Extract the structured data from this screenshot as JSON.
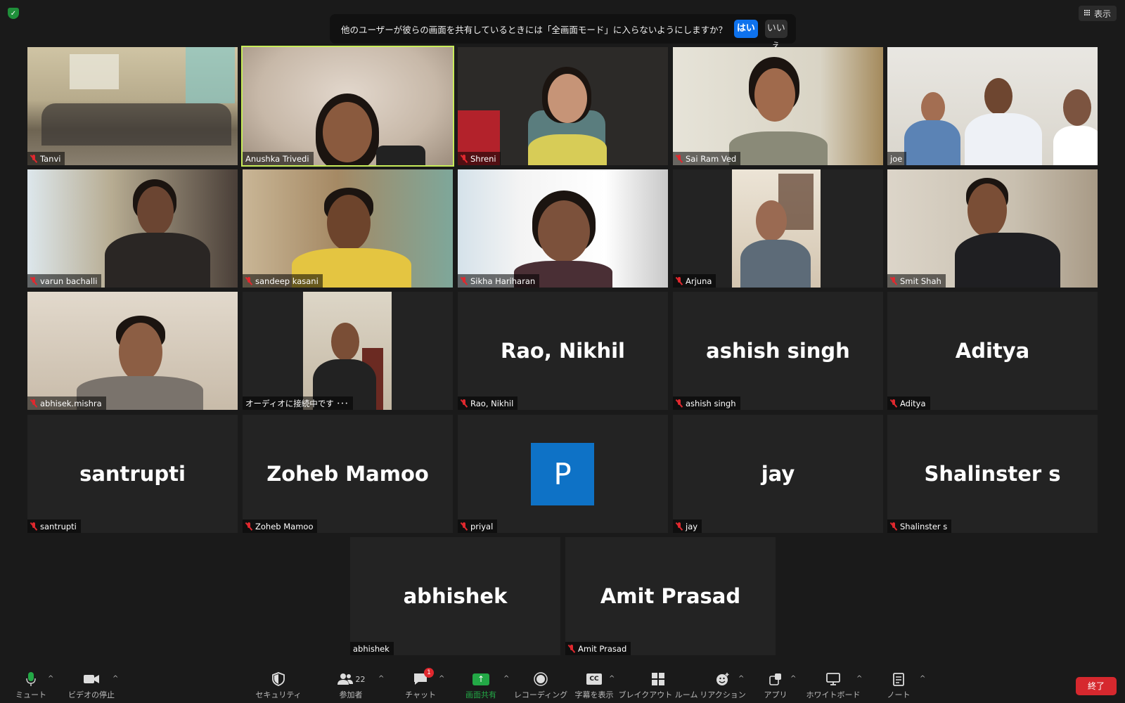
{
  "top": {
    "view_label": "表示",
    "banner_text": "他のユーザーが彼らの画面を共有しているときには「全画面モード」に入らないようにしますか？",
    "yes_label": "はい",
    "no_label": "いいえ"
  },
  "participants": [
    {
      "name": "Tanvi",
      "muted": true
    },
    {
      "name": "Anushka Trivedi",
      "muted": false
    },
    {
      "name": "Shreni",
      "muted": true
    },
    {
      "name": "Sai Ram Ved",
      "muted": true
    },
    {
      "name": "joe",
      "muted": false
    },
    {
      "name": "varun bachalli",
      "muted": true
    },
    {
      "name": "sandeep kasani",
      "muted": true
    },
    {
      "name": "Sikha Hariharan",
      "muted": true
    },
    {
      "name": "Arjuna",
      "muted": true
    },
    {
      "name": "Smit Shah",
      "muted": true
    },
    {
      "name": "abhisek.mishra",
      "muted": true
    },
    {
      "name": "オーディオに接続中です ･･･",
      "muted": false
    },
    {
      "name": "Rao, Nikhil",
      "big": "Rao, Nikhil",
      "muted": true
    },
    {
      "name": "ashish singh",
      "big": "ashish singh",
      "muted": true
    },
    {
      "name": "Aditya",
      "big": "Aditya",
      "muted": true
    },
    {
      "name": "santrupti",
      "big": "santrupti",
      "muted": true
    },
    {
      "name": "Zoheb Mamoo",
      "big": "Zoheb Mamoo",
      "muted": true
    },
    {
      "name": "priyal",
      "avatar_letter": "P",
      "muted": true
    },
    {
      "name": "jay",
      "big": "jay",
      "muted": true
    },
    {
      "name": "Shalinster s",
      "big": "Shalinster s",
      "muted": true
    },
    {
      "name": "abhishek",
      "big": "abhishek",
      "muted": false
    },
    {
      "name": "Amit Prasad",
      "big": "Amit Prasad",
      "muted": true
    }
  ],
  "toolbar": {
    "mute": "ミュート",
    "video": "ビデオの停止",
    "security": "セキュリティ",
    "participants": "参加者",
    "participants_count": "22",
    "chat": "チャット",
    "chat_badge": "1",
    "share": "画面共有",
    "record": "レコーディング",
    "cc_icon_text": "CC",
    "captions": "字幕を表示",
    "breakout": "ブレイクアウト ルーム",
    "reactions": "リアクション",
    "apps": "アプリ",
    "whiteboard": "ホワイトボード",
    "notes": "ノート",
    "end": "終了"
  },
  "colors": {
    "accent_blue": "#0e72ed",
    "active_speaker": "#c8ec5a",
    "end_red": "#d6282e",
    "share_green": "#23a846",
    "muted_red": "#e0282e"
  }
}
